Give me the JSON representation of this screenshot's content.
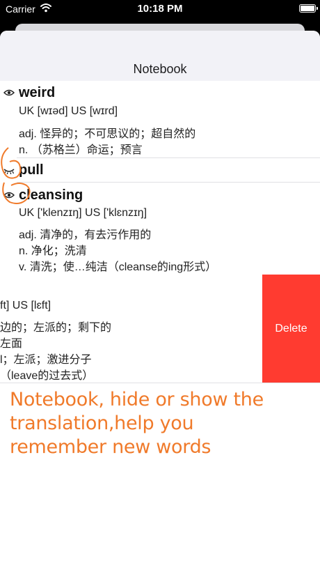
{
  "status_bar": {
    "carrier": "Carrier",
    "time": "10:18 PM"
  },
  "nav": {
    "title": "Notebook"
  },
  "entries": [
    {
      "word": "weird",
      "phonetic": "UK [wɪəd]   US [wɪrd]",
      "definitions": [
        "adj. 怪异的；不可思议的；超自然的",
        "n. （苏格兰）命运；预言"
      ]
    },
    {
      "word": "pull"
    },
    {
      "word": "cleansing",
      "phonetic": "UK ['klenzɪŋ]   US ['klɛnzɪŋ]",
      "definitions": [
        "adj. 清净的，有去污作用的",
        "n. 净化；洗清",
        "v. 清洗；使…纯洁（cleanse的ing形式）"
      ]
    },
    {
      "phonetic": "ft]   US [lɛft]",
      "definitions": [
        "边的；左派的；剩下的",
        "左面",
        "l；左派；激进分子",
        "（leave的过去式）"
      ]
    }
  ],
  "delete_label": "Delete",
  "promo": {
    "lines": [
      "Notebook, hide or show the",
      "translation,help you",
      "remember new words"
    ]
  },
  "colors": {
    "accent": "#f07a2a",
    "delete": "#ff3b30"
  }
}
